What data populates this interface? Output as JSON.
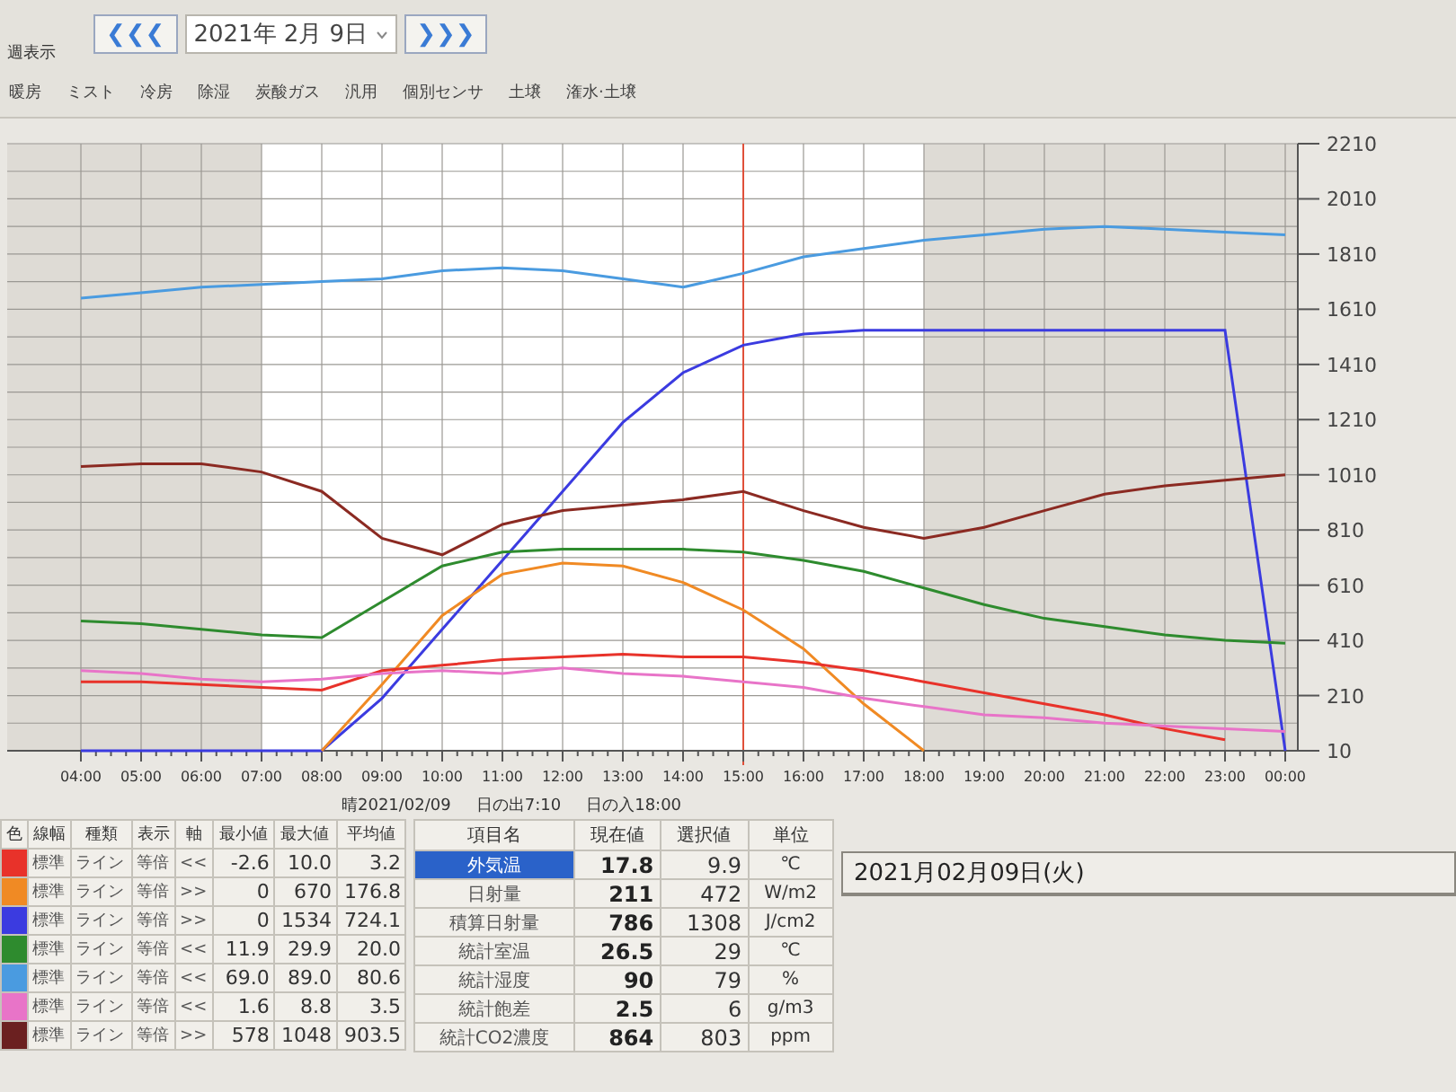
{
  "window": {
    "title": "週表示"
  },
  "navigation": {
    "prev_button": "❮❮❮",
    "date": "2021年 2月 9日",
    "next_button": "❯❯❯"
  },
  "tabs": [
    {
      "label": "暖房",
      "selected": false
    },
    {
      "label": "ミスト",
      "selected": false
    },
    {
      "label": "冷房",
      "selected": false
    },
    {
      "label": "除湿",
      "selected": false
    },
    {
      "label": "炭酸ガス",
      "selected": false
    },
    {
      "label": "汎用",
      "selected": false
    },
    {
      "label": "個別センサ",
      "selected": false
    },
    {
      "label": "土壌",
      "selected": false
    },
    {
      "label": "潅水·土壌",
      "selected": false
    }
  ],
  "chart": {
    "chart_data": {
      "type": "line",
      "categories": [
        "04:00",
        "05:00",
        "06:00",
        "07:00",
        "08:00",
        "09:00",
        "10:00",
        "11:00",
        "12:00",
        "13:00",
        "14:00",
        "15:00",
        "16:00",
        "17:00",
        "18:00",
        "19:00",
        "20:00",
        "21:00",
        "22:00",
        "23:00",
        "00:00"
      ],
      "ylim": [
        10,
        2210
      ],
      "grid": true,
      "ref_lines": [
        {
          "axis": "x",
          "value": "15:00",
          "color": "#e0503a"
        }
      ],
      "yticks": [
        10,
        210,
        410,
        610,
        810,
        1010,
        1210,
        1410,
        1610,
        1810,
        2010,
        2210
      ],
      "series": [
        {
          "color": "#4a9be0",
          "values": [
            1650,
            1670,
            1690,
            1700,
            1710,
            1720,
            1750,
            1760,
            1750,
            1720,
            1690,
            1740,
            1800,
            1830,
            1860,
            1880,
            1900,
            1910,
            1900,
            1890,
            1880
          ]
        },
        {
          "color": "#3b3be0",
          "values": [
            10,
            10,
            10,
            10,
            10,
            200,
            450,
            700,
            950,
            1200,
            1380,
            1480,
            1520,
            1534,
            1534,
            1534,
            1534,
            1534,
            1534,
            1534,
            10
          ]
        },
        {
          "color": "#8b2a22",
          "values": [
            1040,
            1050,
            1050,
            1020,
            950,
            780,
            720,
            830,
            880,
            900,
            920,
            950,
            880,
            820,
            780,
            820,
            880,
            940,
            970,
            990,
            1010
          ]
        },
        {
          "color": "#2e8b2e",
          "values": [
            480,
            470,
            450,
            430,
            420,
            550,
            680,
            730,
            740,
            740,
            740,
            730,
            700,
            660,
            600,
            540,
            490,
            460,
            430,
            410,
            400
          ]
        },
        {
          "color": "#f08a24",
          "values": [
            null,
            null,
            null,
            null,
            10,
            250,
            500,
            650,
            690,
            680,
            620,
            520,
            380,
            180,
            10,
            null,
            null,
            null,
            null,
            null,
            null
          ]
        },
        {
          "color": "#e8322a",
          "values": [
            260,
            260,
            250,
            240,
            230,
            300,
            320,
            340,
            350,
            360,
            350,
            350,
            330,
            300,
            260,
            220,
            180,
            140,
            90,
            50,
            null
          ]
        },
        {
          "color": "#e874c8",
          "values": [
            300,
            290,
            270,
            260,
            270,
            290,
            300,
            290,
            310,
            290,
            280,
            260,
            240,
            200,
            170,
            140,
            130,
            110,
            100,
            90,
            80
          ]
        }
      ]
    },
    "weather_date": "晴2021/02/09",
    "sunrise": "日の出7:10",
    "sunset": "日の入18:00"
  },
  "legend_table": {
    "columns": [
      "色",
      "線幅",
      "種類",
      "表示",
      "軸",
      "最小値",
      "最大値",
      "平均値"
    ],
    "rows": [
      {
        "color": "#e8322a",
        "line_width": "標準",
        "line_type": "ライン",
        "scale": "等倍",
        "axis": "<<",
        "min": "-2.6",
        "max": "10.0",
        "avg": "3.2"
      },
      {
        "color": "#f08a24",
        "line_width": "標準",
        "line_type": "ライン",
        "scale": "等倍",
        "axis": ">>",
        "min": "0",
        "max": "670",
        "avg": "176.8"
      },
      {
        "color": "#3b3be0",
        "line_width": "標準",
        "line_type": "ライン",
        "scale": "等倍",
        "axis": ">>",
        "min": "0",
        "max": "1534",
        "avg": "724.1"
      },
      {
        "color": "#2e8b2e",
        "line_width": "標準",
        "line_type": "ライン",
        "scale": "等倍",
        "axis": "<<",
        "min": "11.9",
        "max": "29.9",
        "avg": "20.0"
      },
      {
        "color": "#4a9be0",
        "line_width": "標準",
        "line_type": "ライン",
        "scale": "等倍",
        "axis": "<<",
        "min": "69.0",
        "max": "89.0",
        "avg": "80.6"
      },
      {
        "color": "#e874c8",
        "line_width": "標準",
        "line_type": "ライン",
        "scale": "等倍",
        "axis": "<<",
        "min": "1.6",
        "max": "8.8",
        "avg": "3.5"
      },
      {
        "color": "#6b2020",
        "line_width": "標準",
        "line_type": "ライン",
        "scale": "等倍",
        "axis": ">>",
        "min": "578",
        "max": "1048",
        "avg": "903.5"
      }
    ]
  },
  "value_table": {
    "columns": [
      "項目名",
      "現在値",
      "選択値",
      "単位"
    ],
    "rows": [
      {
        "name": "外気温",
        "current": "17.8",
        "selected_value": "9.9",
        "unit": "℃",
        "selected": true
      },
      {
        "name": "日射量",
        "current": "211",
        "selected_value": "472",
        "unit": "W/m2",
        "selected": false
      },
      {
        "name": "積算日射量",
        "current": "786",
        "selected_value": "1308",
        "unit": "J/cm2",
        "selected": false
      },
      {
        "name": "統計室温",
        "current": "26.5",
        "selected_value": "29",
        "unit": "℃",
        "selected": false
      },
      {
        "name": "統計湿度",
        "current": "90",
        "selected_value": "79",
        "unit": "%",
        "selected": false
      },
      {
        "name": "統計飽差",
        "current": "2.5",
        "selected_value": "6",
        "unit": "g/m3",
        "selected": false
      },
      {
        "name": "統計CO2濃度",
        "current": "864",
        "selected_value": "803",
        "unit": "ppm",
        "selected": false
      }
    ]
  },
  "date_panel": {
    "title": "2021月02月09日(火)"
  }
}
